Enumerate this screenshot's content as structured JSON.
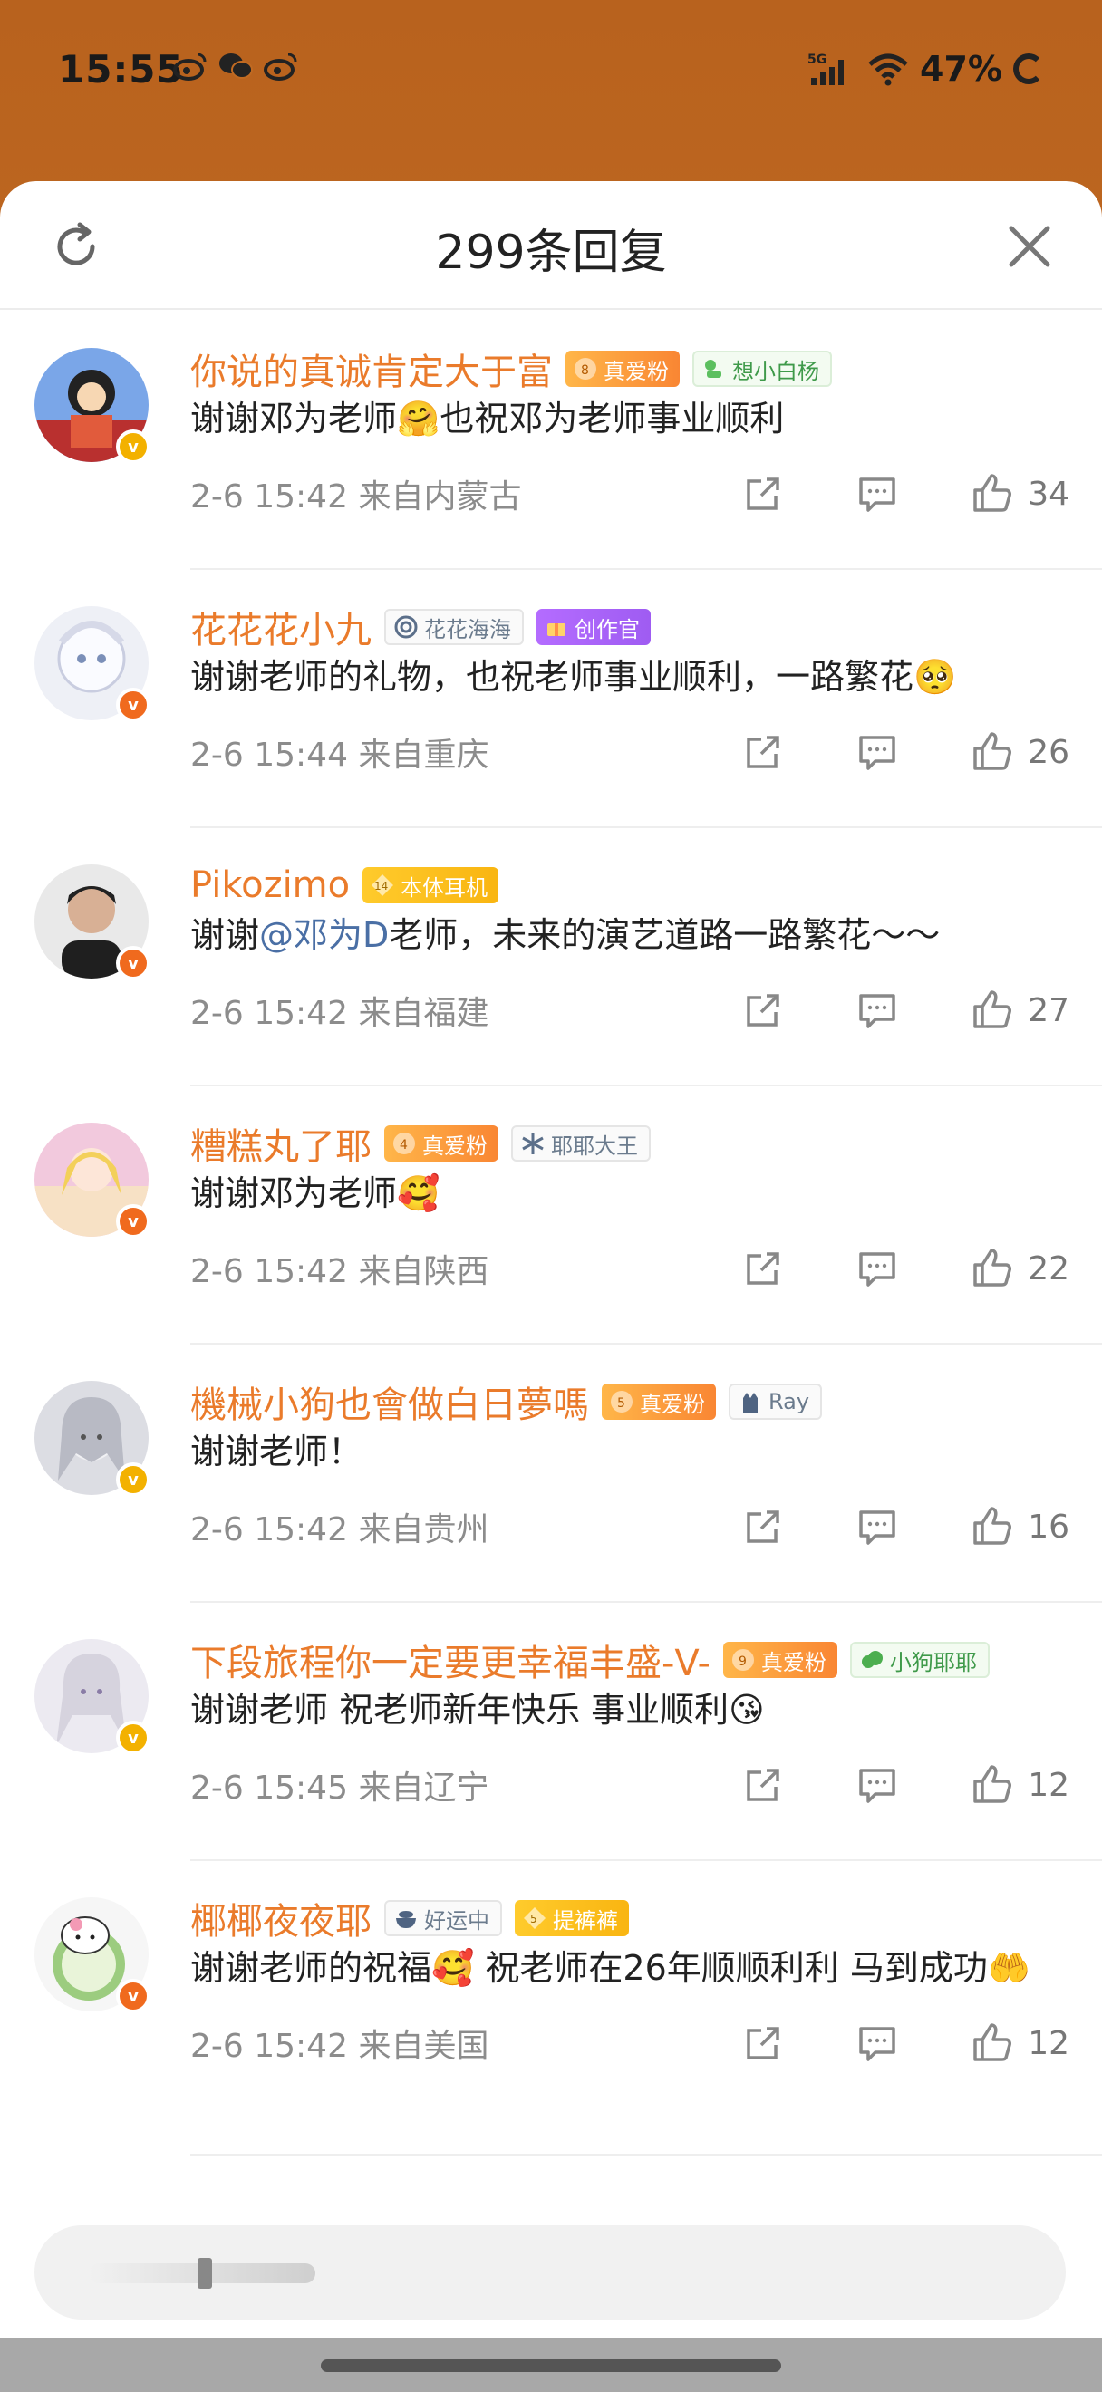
{
  "status": {
    "time": "15:55",
    "network": "5G",
    "battery": "47%"
  },
  "sheet": {
    "title": "299条回复"
  },
  "comments": [
    {
      "name": "你说的真诚肯定大于富",
      "badges": [
        {
          "kind": "fan",
          "level": "8",
          "label": "真爱粉"
        },
        {
          "kind": "green",
          "label": "想小白杨"
        }
      ],
      "text": "谢谢邓为老师🤗也祝邓为老师事业顺利",
      "date": "2-6 15:42",
      "location": "来自内蒙古",
      "likes": "34",
      "verified": "yellow"
    },
    {
      "name": "花花花小九",
      "badges": [
        {
          "kind": "plain",
          "label": "花花海海"
        },
        {
          "kind": "purple",
          "label": "创作官"
        }
      ],
      "text": "谢谢老师的礼物，也祝老师事业顺利，一路繁花🥺",
      "date": "2-6 15:44",
      "location": "来自重庆",
      "likes": "26",
      "verified": "orange"
    },
    {
      "name": "Pikozimo",
      "badges": [
        {
          "kind": "gold",
          "level": "14",
          "label": "本体耳机"
        }
      ],
      "text_pre": "谢谢",
      "mention": "@邓为D",
      "text_post": "老师，未来的演艺道路一路繁花～～",
      "date": "2-6 15:42",
      "location": "来自福建",
      "likes": "27",
      "verified": "orange"
    },
    {
      "name": "糟糕丸了耶",
      "badges": [
        {
          "kind": "fan",
          "level": "4",
          "label": "真爱粉"
        },
        {
          "kind": "plain",
          "label": "耶耶大王"
        }
      ],
      "text": "谢谢邓为老师🥰",
      "date": "2-6 15:42",
      "location": "来自陕西",
      "likes": "22",
      "verified": "orange"
    },
    {
      "name": "機械小狗也會做白日夢嗎",
      "badges": [
        {
          "kind": "fan",
          "level": "5",
          "label": "真爱粉"
        },
        {
          "kind": "plain",
          "label": "Ray"
        }
      ],
      "text": "谢谢老师！",
      "date": "2-6 15:42",
      "location": "来自贵州",
      "likes": "16",
      "verified": "yellow"
    },
    {
      "name": "下段旅程你一定要更幸福丰盛-V-",
      "badges": [
        {
          "kind": "fan",
          "level": "9",
          "label": "真爱粉"
        },
        {
          "kind": "green",
          "label": "小狗耶耶"
        }
      ],
      "text": "谢谢老师 祝老师新年快乐 事业顺利😘",
      "date": "2-6 15:45",
      "location": "来自辽宁",
      "likes": "12",
      "verified": "yellow"
    },
    {
      "name": "椰椰夜夜耶",
      "badges": [
        {
          "kind": "plain",
          "label": "好运中"
        },
        {
          "kind": "gold",
          "level": "5",
          "label": "提裤裤"
        }
      ],
      "text": "谢谢老师的祝福🥰 祝老师在26年顺顺利利 马到成功🤲",
      "date": "2-6 15:42",
      "location": "来自美国",
      "likes": "12",
      "verified": "orange"
    }
  ],
  "colors": {
    "username": "#ea7b2b",
    "mention": "#4a6fa5",
    "meta": "#8c8c8c",
    "background_orange": "#c86c22"
  },
  "icons": [
    "refresh-icon",
    "close-icon",
    "share-icon",
    "reply-icon",
    "like-icon",
    "weibo-icon",
    "wechat-icon",
    "wifi-icon",
    "signal-icon"
  ]
}
